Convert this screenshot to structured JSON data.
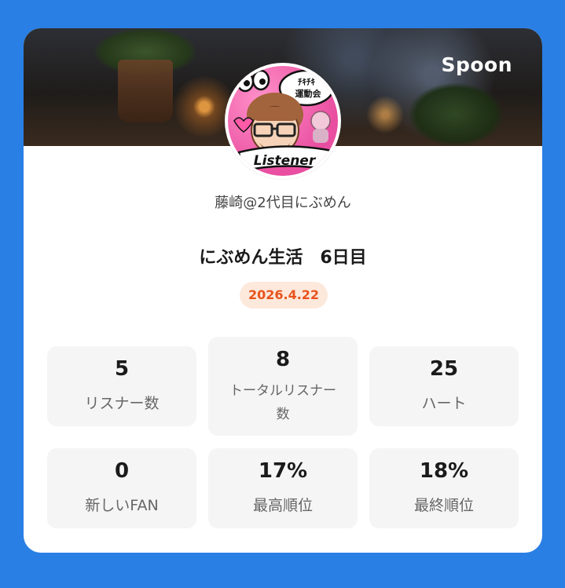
{
  "brand": {
    "logo_text": "Spoon",
    "background_color": "#2a7fe4"
  },
  "profile": {
    "username": "藤崎@2代目にぶめん",
    "avatar_texts": [
      "ﾁｷﾁｷ",
      "運動会",
      "Listener"
    ]
  },
  "broadcast": {
    "title": "にぶめん生活　6日目",
    "date": "2026.4.22",
    "date_color": "#e8531c"
  },
  "stats": [
    {
      "value": "5",
      "label": "リスナー数"
    },
    {
      "value": "8",
      "label": "トータルリスナー数"
    },
    {
      "value": "25",
      "label": "ハート"
    },
    {
      "value": "0",
      "label": "新しいFAN"
    },
    {
      "value": "17%",
      "label": "最高順位"
    },
    {
      "value": "18%",
      "label": "最終順位"
    }
  ]
}
